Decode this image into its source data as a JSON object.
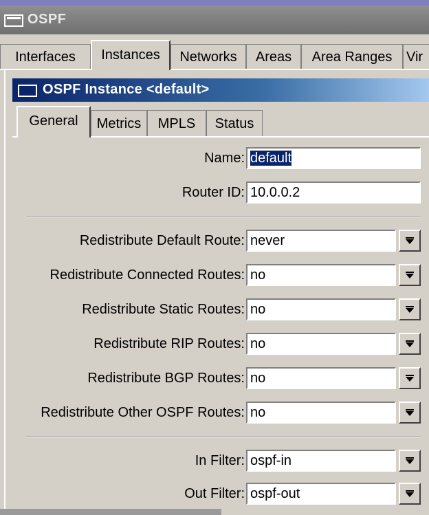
{
  "outer_window": {
    "title": "OSPF"
  },
  "outer_tabs": [
    {
      "label": "Interfaces",
      "active": false
    },
    {
      "label": "Instances",
      "active": true
    },
    {
      "label": "Networks",
      "active": false
    },
    {
      "label": "Areas",
      "active": false
    },
    {
      "label": "Area Ranges",
      "active": false
    },
    {
      "label": "Vir",
      "active": false
    }
  ],
  "dialog": {
    "title": "OSPF Instance <default>",
    "tabs": [
      {
        "label": "General",
        "active": true
      },
      {
        "label": "Metrics",
        "active": false
      },
      {
        "label": "MPLS",
        "active": false
      },
      {
        "label": "Status",
        "active": false
      }
    ],
    "fields": {
      "name": {
        "label": "Name:",
        "value": "default"
      },
      "router_id": {
        "label": "Router ID:",
        "value": "10.0.0.2"
      },
      "redist_default": {
        "label": "Redistribute Default Route:",
        "value": "never"
      },
      "redist_connected": {
        "label": "Redistribute Connected Routes:",
        "value": "no"
      },
      "redist_static": {
        "label": "Redistribute Static Routes:",
        "value": "no"
      },
      "redist_rip": {
        "label": "Redistribute RIP Routes:",
        "value": "no"
      },
      "redist_bgp": {
        "label": "Redistribute BGP Routes:",
        "value": "no"
      },
      "redist_other_ospf": {
        "label": "Redistribute Other OSPF Routes:",
        "value": "no"
      },
      "in_filter": {
        "label": "In Filter:",
        "value": "ospf-in"
      },
      "out_filter": {
        "label": "Out Filter:",
        "value": "ospf-out"
      }
    }
  },
  "icons": {
    "window": "window-icon",
    "dropdown": "dropdown-arrow-icon"
  },
  "colors": {
    "title_active": "#0a246a",
    "title_inactive": "#7f7f7f",
    "face": "#d4d0c8",
    "selection": "#0a246a"
  }
}
